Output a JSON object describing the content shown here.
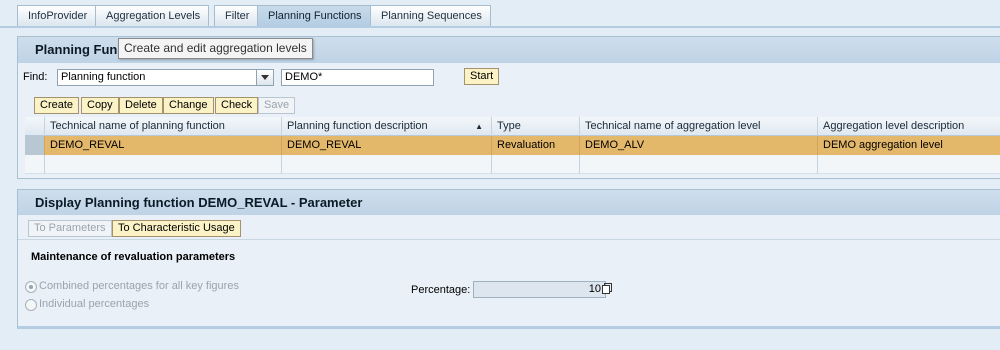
{
  "tabs": [
    "InfoProvider",
    "Aggregation Levels",
    "Filter",
    "Planning Functions",
    "Planning Sequences"
  ],
  "active_tab": "Planning Functions",
  "tooltip": "Create and edit aggregation levels",
  "planning_tray": {
    "title": "Planning Fun",
    "find_label": "Find:",
    "find_type_value": "Planning function",
    "find_pattern_value": "DEMO*",
    "start_label": "Start",
    "toolbar": {
      "create": "Create",
      "copy": "Copy",
      "delete": "Delete",
      "change": "Change",
      "check": "Check",
      "save": "Save"
    },
    "table": {
      "headers": [
        "Technical name of planning function",
        "Planning function description",
        "Type",
        "Technical name of aggregation level",
        "Aggregation level description"
      ],
      "sort_indicator": "▲",
      "rows": [
        [
          "DEMO_REVAL",
          "DEMO_REVAL",
          "Revaluation",
          "DEMO_ALV",
          "DEMO aggregation level"
        ]
      ]
    }
  },
  "display_tray": {
    "title": "Display Planning function DEMO_REVAL - Parameter",
    "to_parameters": "To Parameters",
    "to_char_usage": "To Characteristic Usage",
    "section_title": "Maintenance of revaluation parameters",
    "radio_combined": "Combined percentages for all key figures",
    "radio_individual": "Individual percentages",
    "radio_selected": "combined",
    "percentage_label": "Percentage:",
    "percentage_value": "10"
  },
  "colors": {
    "accent_button": "#fbf3c6",
    "selected_row": "#e4b86a",
    "tray_header": "#c5d8ea"
  }
}
